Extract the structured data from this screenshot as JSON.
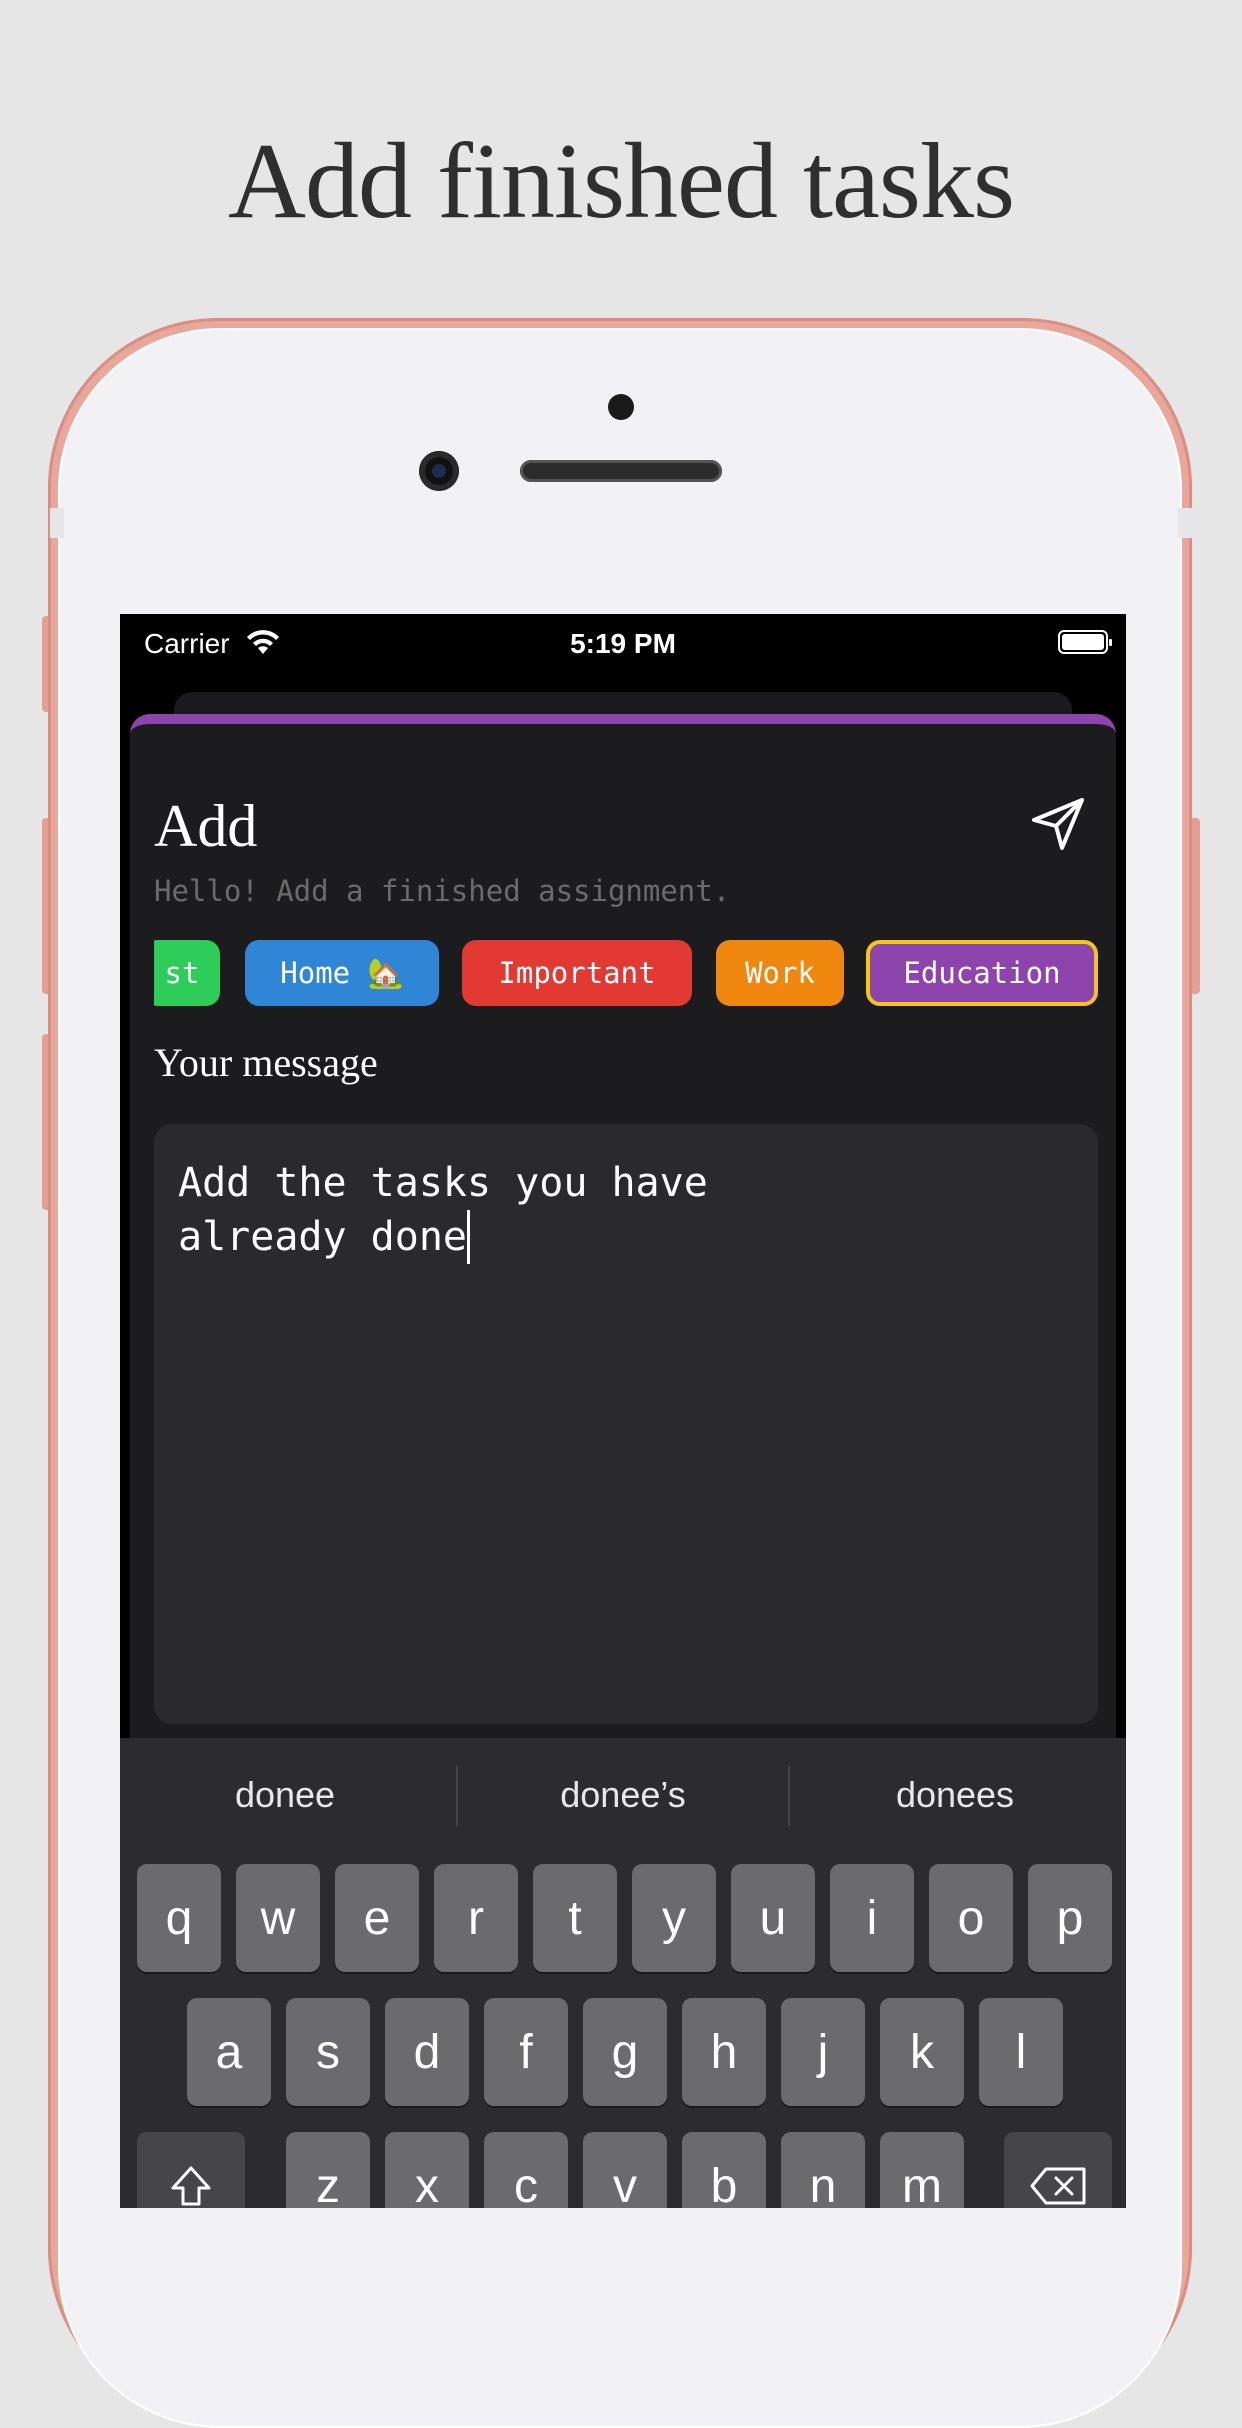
{
  "headline": "Add finished tasks",
  "status_bar": {
    "carrier": "Carrier",
    "time": "5:19 PM"
  },
  "sheet": {
    "title": "Add",
    "subtitle": "Hello! Add a finished assignment.",
    "accent_color": "#8e44ad"
  },
  "categories": [
    {
      "label": "st",
      "color": "#2ecc59",
      "selected": false
    },
    {
      "label": "Home 🏡",
      "color": "#2f86d6",
      "selected": false
    },
    {
      "label": "Important",
      "color": "#e23a33",
      "selected": false
    },
    {
      "label": "Work",
      "color": "#f0870f",
      "selected": false
    },
    {
      "label": "Education",
      "color": "#8e44ad",
      "selected": true,
      "border_color": "#f5c518"
    }
  ],
  "message": {
    "label": "Your message",
    "line1": "Add the tasks you have",
    "line2": "already done"
  },
  "keyboard": {
    "suggestions": [
      "donee",
      "donee’s",
      "donees"
    ],
    "row1": [
      "q",
      "w",
      "e",
      "r",
      "t",
      "y",
      "u",
      "i",
      "o",
      "p"
    ],
    "row2": [
      "a",
      "s",
      "d",
      "f",
      "g",
      "h",
      "j",
      "k",
      "l"
    ],
    "row3": [
      "z",
      "x",
      "c",
      "v",
      "b",
      "n",
      "m"
    ],
    "shift_icon": "shift-icon",
    "delete_icon": "delete-icon"
  }
}
